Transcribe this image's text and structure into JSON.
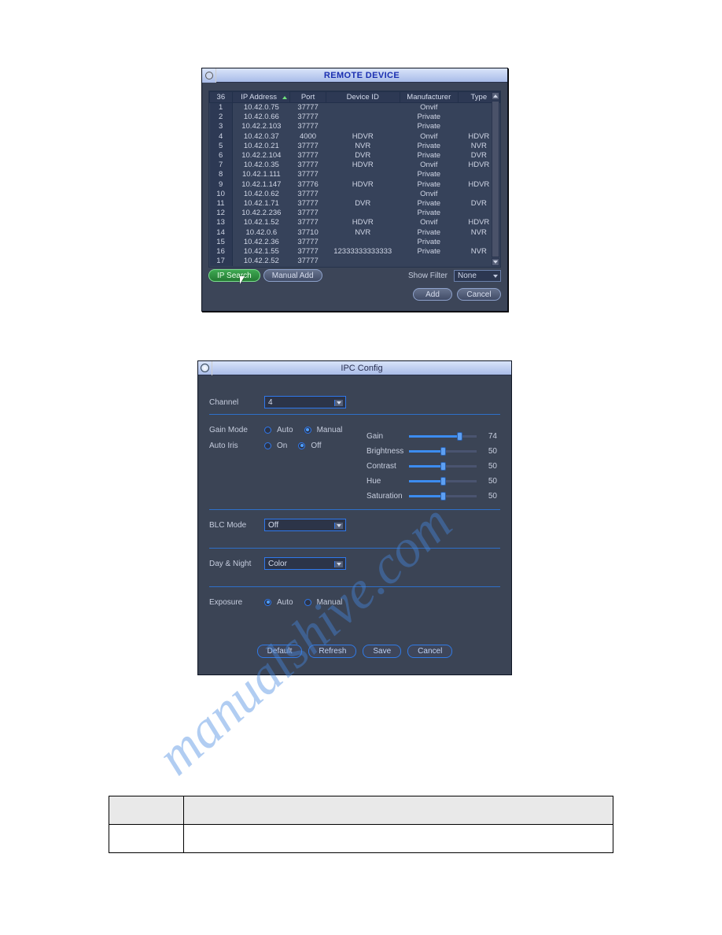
{
  "watermark_text": "manualshive.com",
  "remote_device": {
    "title": "REMOTE DEVICE",
    "columns": [
      "36",
      "IP Address",
      "Port",
      "Device ID",
      "Manufacturer",
      "Type"
    ],
    "rows": [
      {
        "n": "1",
        "ip": "10.42.0.75",
        "port": "37777",
        "id": "",
        "mfr": "Onvif",
        "type": ""
      },
      {
        "n": "2",
        "ip": "10.42.0.66",
        "port": "37777",
        "id": "",
        "mfr": "Private",
        "type": ""
      },
      {
        "n": "3",
        "ip": "10.42.2.103",
        "port": "37777",
        "id": "",
        "mfr": "Private",
        "type": ""
      },
      {
        "n": "4",
        "ip": "10.42.0.37",
        "port": "4000",
        "id": "HDVR",
        "mfr": "Onvif",
        "type": "HDVR"
      },
      {
        "n": "5",
        "ip": "10.42.0.21",
        "port": "37777",
        "id": "NVR",
        "mfr": "Private",
        "type": "NVR"
      },
      {
        "n": "6",
        "ip": "10.42.2.104",
        "port": "37777",
        "id": "DVR",
        "mfr": "Private",
        "type": "DVR"
      },
      {
        "n": "7",
        "ip": "10.42.0.35",
        "port": "37777",
        "id": "HDVR",
        "mfr": "Onvif",
        "type": "HDVR"
      },
      {
        "n": "8",
        "ip": "10.42.1.111",
        "port": "37777",
        "id": "",
        "mfr": "Private",
        "type": ""
      },
      {
        "n": "9",
        "ip": "10.42.1.147",
        "port": "37776",
        "id": "HDVR",
        "mfr": "Private",
        "type": "HDVR"
      },
      {
        "n": "10",
        "ip": "10.42.0.62",
        "port": "37777",
        "id": "",
        "mfr": "Onvif",
        "type": ""
      },
      {
        "n": "11",
        "ip": "10.42.1.71",
        "port": "37777",
        "id": "DVR",
        "mfr": "Private",
        "type": "DVR"
      },
      {
        "n": "12",
        "ip": "10.42.2.236",
        "port": "37777",
        "id": "",
        "mfr": "Private",
        "type": ""
      },
      {
        "n": "13",
        "ip": "10.42.1.52",
        "port": "37777",
        "id": "HDVR",
        "mfr": "Onvif",
        "type": "HDVR"
      },
      {
        "n": "14",
        "ip": "10.42.0.6",
        "port": "37710",
        "id": "NVR",
        "mfr": "Private",
        "type": "NVR"
      },
      {
        "n": "15",
        "ip": "10.42.2.36",
        "port": "37777",
        "id": "",
        "mfr": "Private",
        "type": ""
      },
      {
        "n": "16",
        "ip": "10.42.1.55",
        "port": "37777",
        "id": "12333333333333",
        "mfr": "Private",
        "type": "NVR"
      },
      {
        "n": "17",
        "ip": "10.42.2.52",
        "port": "37777",
        "id": "",
        "mfr": "",
        "type": ""
      }
    ],
    "ip_search": "IP Search",
    "manual_add": "Manual Add",
    "show_filter_label": "Show Filter",
    "show_filter_value": "None",
    "add": "Add",
    "cancel": "Cancel"
  },
  "ipc": {
    "title": "IPC Config",
    "channel_label": "Channel",
    "channel_value": "4",
    "gain_mode_label": "Gain Mode",
    "gain_mode_auto": "Auto",
    "gain_mode_manual": "Manual",
    "auto_iris_label": "Auto Iris",
    "auto_iris_on": "On",
    "auto_iris_off": "Off",
    "sliders": {
      "gain": {
        "label": "Gain",
        "value": 74
      },
      "brightness": {
        "label": "Brightness",
        "value": 50
      },
      "contrast": {
        "label": "Contrast",
        "value": 50
      },
      "hue": {
        "label": "Hue",
        "value": 50
      },
      "saturation": {
        "label": "Saturation",
        "value": 50
      }
    },
    "blc_label": "BLC Mode",
    "blc_value": "Off",
    "dn_label": "Day & Night",
    "dn_value": "Color",
    "exposure_label": "Exposure",
    "exposure_auto": "Auto",
    "exposure_manual": "Manual",
    "btn_default": "Default",
    "btn_refresh": "Refresh",
    "btn_save": "Save",
    "btn_cancel": "Cancel"
  },
  "param_table": {
    "h1": "",
    "h2": "",
    "r1c1": "",
    "r1c2": ""
  }
}
